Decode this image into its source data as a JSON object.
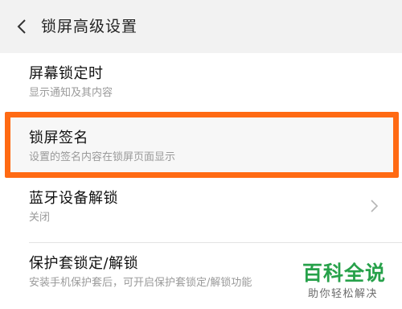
{
  "header": {
    "title": "锁屏高级设置",
    "back_icon": "chevron-left-icon"
  },
  "items": [
    {
      "title": "屏幕锁定时",
      "subtitle": "显示通知及其内容"
    },
    {
      "title": "锁屏签名",
      "subtitle": "设置的签名内容在锁屏页面显示",
      "highlighted": true
    },
    {
      "title": "蓝牙设备解锁",
      "subtitle": "关闭",
      "trailing_icon": "chevron-right-icon"
    },
    {
      "title": "保护套锁定/解锁",
      "subtitle": "安装手机保护套后，可开启保护套锁定/解锁功能"
    }
  ],
  "watermark": {
    "main": "百科全说",
    "sub": "助你轻松解决"
  },
  "colors": {
    "highlight_border": "#ff6a13",
    "watermark_green": "#27a14a",
    "header_bg": "#f2f2f2"
  }
}
